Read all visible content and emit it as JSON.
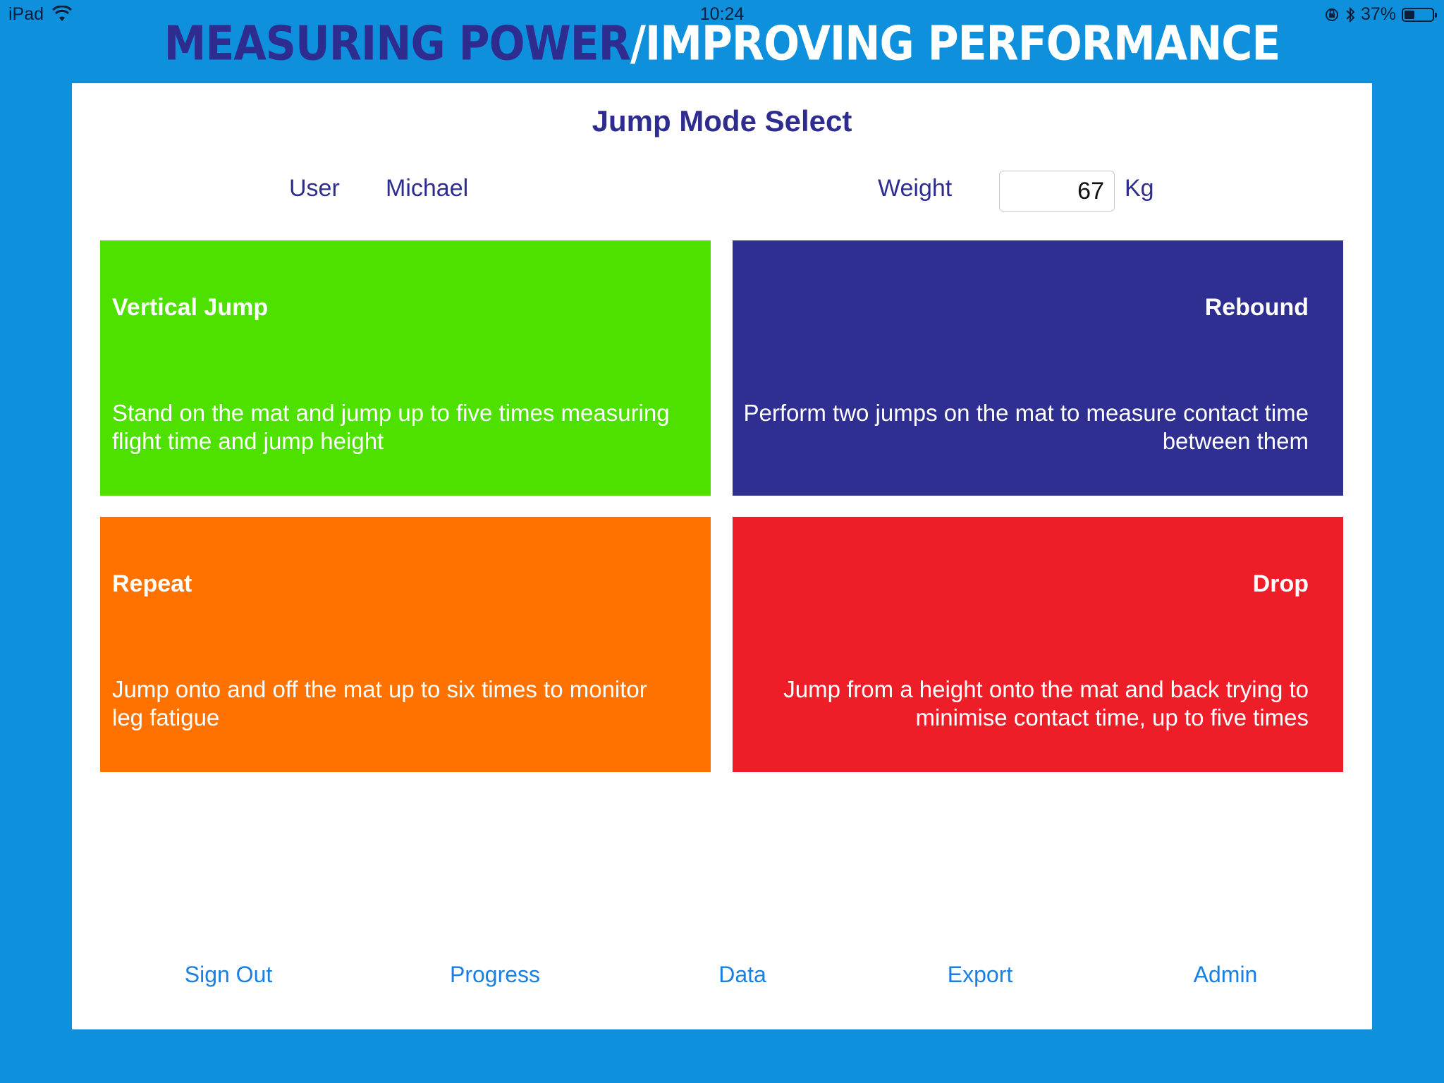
{
  "status_bar": {
    "device": "iPad",
    "time": "10:24",
    "battery": "37%",
    "battery_level": 0.37
  },
  "banner": {
    "part1": "MEASURING POWER",
    "part2": "/IMPROVING PERFORMANCE"
  },
  "page": {
    "title": "Jump Mode Select",
    "user_label": "User",
    "user_name": "Michael",
    "weight_label": "Weight",
    "weight_value": "67",
    "weight_unit": "Kg"
  },
  "tiles": [
    {
      "title": "Vertical Jump",
      "description": "Stand on the mat and jump up to five times measuring flight time and jump height",
      "color": "#4ee100"
    },
    {
      "title": "Rebound",
      "description": "Perform two jumps on the mat to measure contact time between them",
      "color": "#2f2f92"
    },
    {
      "title": "Repeat",
      "description": "Jump onto and off the mat up to six times to monitor leg fatigue",
      "color": "#ff7200"
    },
    {
      "title": "Drop",
      "description": "Jump from a height onto the mat and back trying to minimise contact time, up to five times",
      "color": "#ee1e28"
    }
  ],
  "nav": {
    "sign_out": "Sign Out",
    "progress": "Progress",
    "data": "Data",
    "export": "Export",
    "admin": "Admin"
  },
  "colors": {
    "background": "#0f90dc",
    "title": "#2e2d8f",
    "link": "#1a7fe0"
  },
  "icons": {
    "wifi": "wifi-icon",
    "orientation_lock": "orientation-lock-icon",
    "bluetooth": "bluetooth-icon",
    "battery": "battery-icon"
  }
}
